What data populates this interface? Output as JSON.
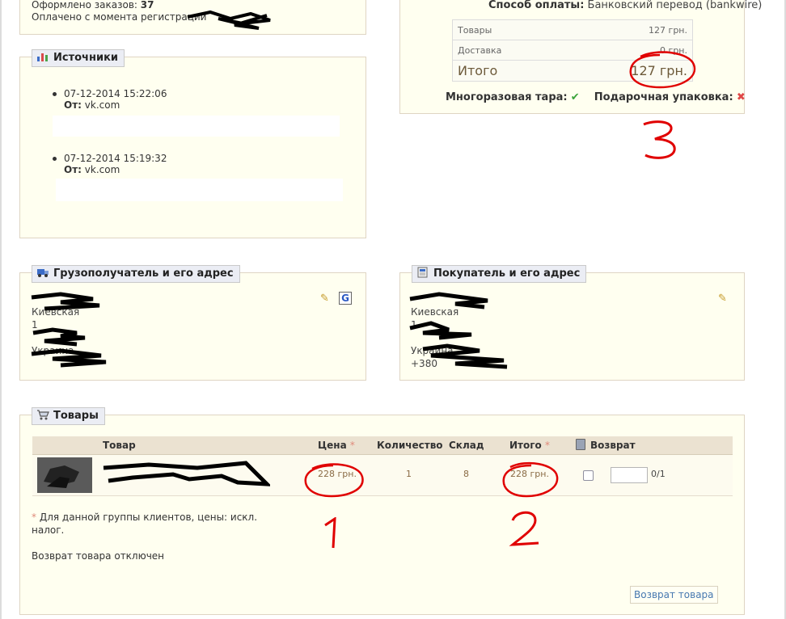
{
  "customer": {
    "orders_label": "Оформлено заказов:",
    "orders_count": "37",
    "paid_label": "Оплачено с момента регистрации"
  },
  "sources": {
    "title": "Источники",
    "items": [
      {
        "date": "07-12-2014 15:22:06",
        "from_label": "От:",
        "from_value": "vk.com"
      },
      {
        "date": "07-12-2014 15:19:32",
        "from_label": "От:",
        "from_value": "vk.com"
      }
    ]
  },
  "payment": {
    "method_label": "Способ оплаты:",
    "method_value": "Банковский перевод (bankwire)",
    "rows": [
      {
        "label": "Товары",
        "value": "127 грн."
      },
      {
        "label": "Доставка",
        "value": "0 грн."
      },
      {
        "label": "Итого",
        "value": "127 грн."
      }
    ],
    "recycled_label": "Многоразовая тара:",
    "gift_label": "Подарочная упаковка:"
  },
  "shipping": {
    "title": "Грузополучатель и его адрес",
    "lines": [
      "Киевская",
      "1",
      "Украина"
    ]
  },
  "invoice": {
    "title": "Покупатель и его адрес",
    "lines": [
      "Киевская",
      "1",
      "Украина",
      "+380"
    ]
  },
  "products": {
    "title": "Товары",
    "columns": {
      "product": "Товар",
      "price": "Цена",
      "price_star": "*",
      "quantity": "Количество",
      "stock": "Склад",
      "total": "Итого",
      "total_star": "*",
      "return": "Возврат"
    },
    "rows": [
      {
        "price": "228 грн.",
        "quantity": "1",
        "stock": "8",
        "total": "228 грн.",
        "return_count": "0/1"
      }
    ],
    "note_star": "*",
    "note_line1": "Для данной группы клиентов, цены: искл.",
    "note_line2": "налог.",
    "returns_disabled": "Возврат товара отключен",
    "return_button": "Возврат товара"
  },
  "annotations": {
    "one": "1",
    "two": "2",
    "three": "3"
  },
  "colors": {
    "panel_bg": "#fffff0",
    "panel_border": "#dfd5c3",
    "legend_bg": "#ebedf4",
    "table_head": "#ebe2d1",
    "price_text": "#8a6b45",
    "annotation_red": "#e00000",
    "link_blue": "#4778b0"
  }
}
